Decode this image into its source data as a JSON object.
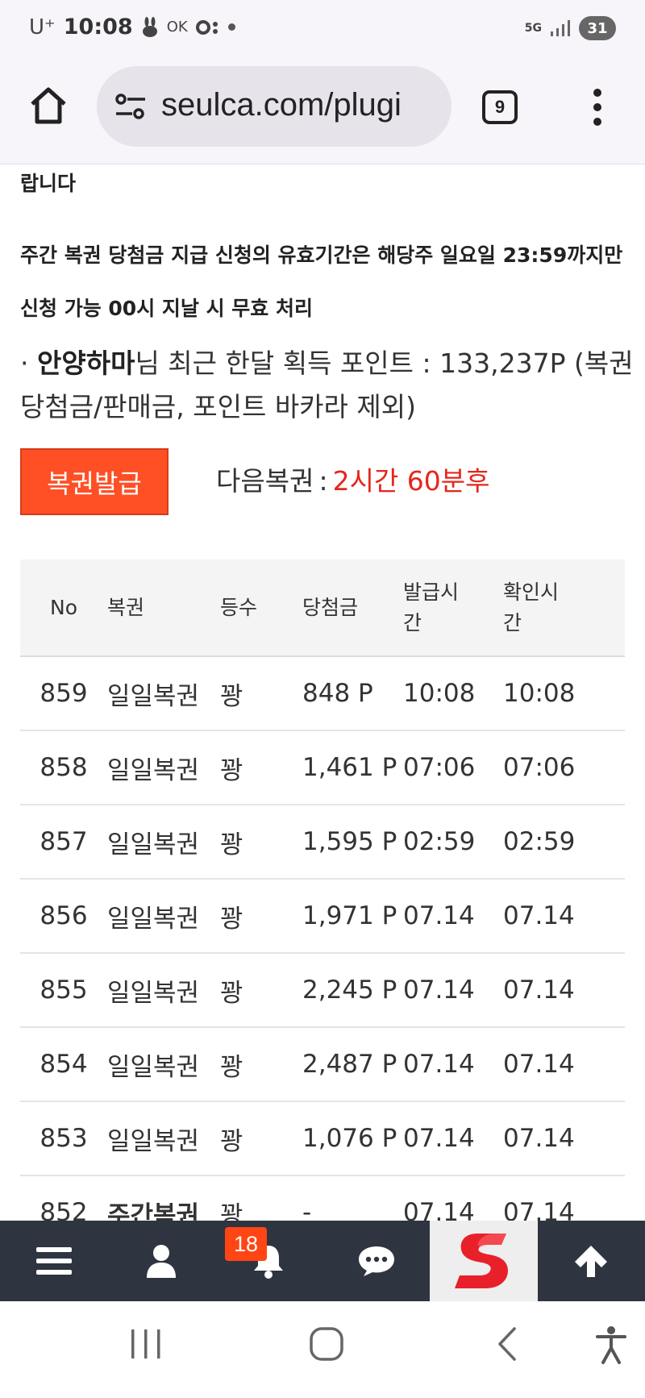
{
  "status_bar": {
    "carrier": "U⁺",
    "time": "10:08",
    "ok_label": "OK",
    "network": "5G",
    "battery": "31"
  },
  "browser": {
    "url": "seulca.com/plugi",
    "tab_count": "9"
  },
  "content": {
    "notice_tail": "랍니다",
    "notice_line1": "주간 복권 당첨금 지급 신청의 유효기간은 해당주 일요일 23:59까지만",
    "notice_line2": "신청 가능 00시 지날 시 무효 처리",
    "points_bullet": "·",
    "points_user": "안양하마",
    "points_text": "님 최근 한달 획득 포인트 : 133,237P (복권 당첨금/판매금, 포인트 바카라 제외)",
    "issue_button": "복권발급",
    "next_label": "다음복권",
    "next_sep": ":",
    "next_value": "2시간 60분후"
  },
  "table": {
    "headers": [
      "No",
      "복권",
      "등수",
      "당첨금",
      "발급시간",
      "확인시간"
    ],
    "rows": [
      {
        "no": "859",
        "ticket": "일일복권",
        "rank": "꽝",
        "prize": "848 P",
        "issued": "10:08",
        "checked": "10:08"
      },
      {
        "no": "858",
        "ticket": "일일복권",
        "rank": "꽝",
        "prize": "1,461 P",
        "issued": "07:06",
        "checked": "07:06"
      },
      {
        "no": "857",
        "ticket": "일일복권",
        "rank": "꽝",
        "prize": "1,595 P",
        "issued": "02:59",
        "checked": "02:59"
      },
      {
        "no": "856",
        "ticket": "일일복권",
        "rank": "꽝",
        "prize": "1,971 P",
        "issued": "07.14",
        "checked": "07.14"
      },
      {
        "no": "855",
        "ticket": "일일복권",
        "rank": "꽝",
        "prize": "2,245 P",
        "issued": "07.14",
        "checked": "07.14"
      },
      {
        "no": "854",
        "ticket": "일일복권",
        "rank": "꽝",
        "prize": "2,487 P",
        "issued": "07.14",
        "checked": "07.14"
      },
      {
        "no": "853",
        "ticket": "일일복권",
        "rank": "꽝",
        "prize": "1,076 P",
        "issued": "07.14",
        "checked": "07.14"
      },
      {
        "no": "852",
        "ticket": "주간복권",
        "rank": "꽝",
        "prize": "-",
        "issued": "07.14",
        "checked": "07.14"
      }
    ]
  },
  "app_nav": {
    "items": [
      "menu-icon",
      "user-icon",
      "bell-icon",
      "chat-icon",
      "site-logo",
      "arrow-up-icon"
    ],
    "notification_count": "18",
    "brand_color": "#e8202a",
    "bar_color": "#2e3540"
  },
  "colors": {
    "issue_button": "#ff4f25",
    "next_value": "#e5261c"
  }
}
